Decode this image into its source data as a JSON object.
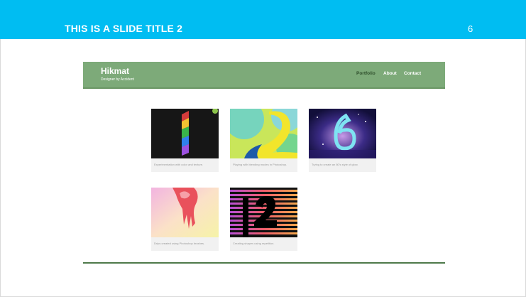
{
  "slide": {
    "title": "THIS IS A SLIDE TITLE 2",
    "number": "6"
  },
  "site": {
    "brand": "Hikmat",
    "tagline": "Designer by Accident",
    "nav": [
      "Portfolio",
      "About",
      "Contact"
    ],
    "active_nav": "Portfolio",
    "colors": {
      "header": "#00bdf2",
      "nav": "#7daa79"
    },
    "cards": [
      {
        "caption": "Experimentation with color and texture."
      },
      {
        "caption": "Playing with blending modes in Photoshop."
      },
      {
        "caption": "Trying to create an 80's style of glow."
      },
      {
        "caption": "Drips created using Photoshop brushes."
      },
      {
        "caption": "Creating shapes using repetition."
      }
    ]
  }
}
